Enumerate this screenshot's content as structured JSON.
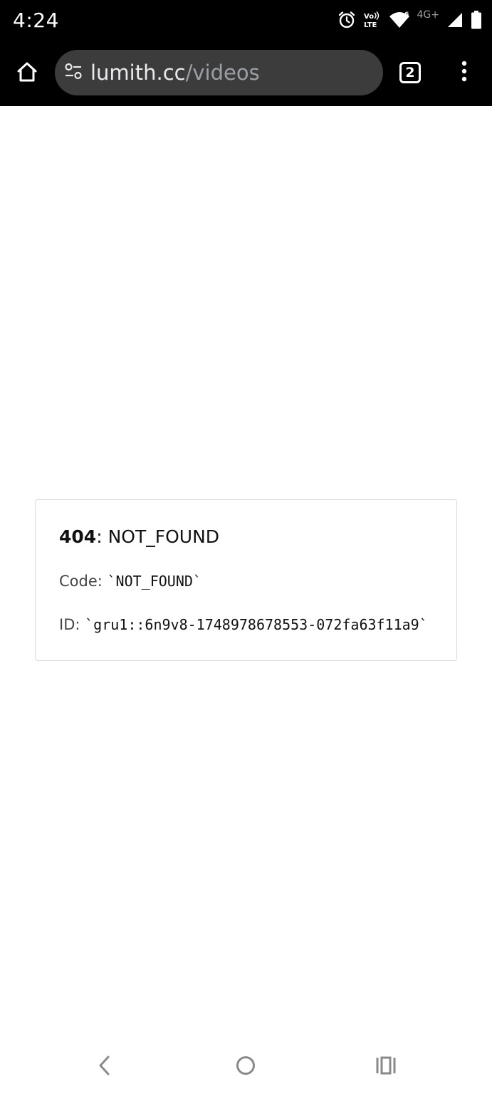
{
  "status_bar": {
    "time": "4:24",
    "network_label": "4G+",
    "icons": [
      "alarm-icon",
      "volte-icon",
      "wifi-icon",
      "signal-icon",
      "battery-icon"
    ]
  },
  "browser": {
    "url_domain": "lumith.cc",
    "url_path": "/videos",
    "tab_count": "2",
    "icons": [
      "home-icon",
      "site-settings-icon",
      "tab-switcher-icon",
      "more-vert-icon"
    ]
  },
  "error": {
    "status_code": "404",
    "title_separator": ": ",
    "status_text": "NOT_FOUND",
    "code_label": "Code: ",
    "code_value": "`NOT_FOUND`",
    "id_label": "ID: ",
    "id_value": "`gru1::6n9v8-1748978678553-072fa63f11a9`"
  },
  "nav_bar": {
    "icons": [
      "back-icon",
      "home-circle-icon",
      "recents-icon"
    ]
  },
  "colors": {
    "status_bar_bg": "#000000",
    "url_bar_bg": "#3c3c3c",
    "url_path_color": "#9aa0a6",
    "card_border": "#dcdcdc"
  }
}
